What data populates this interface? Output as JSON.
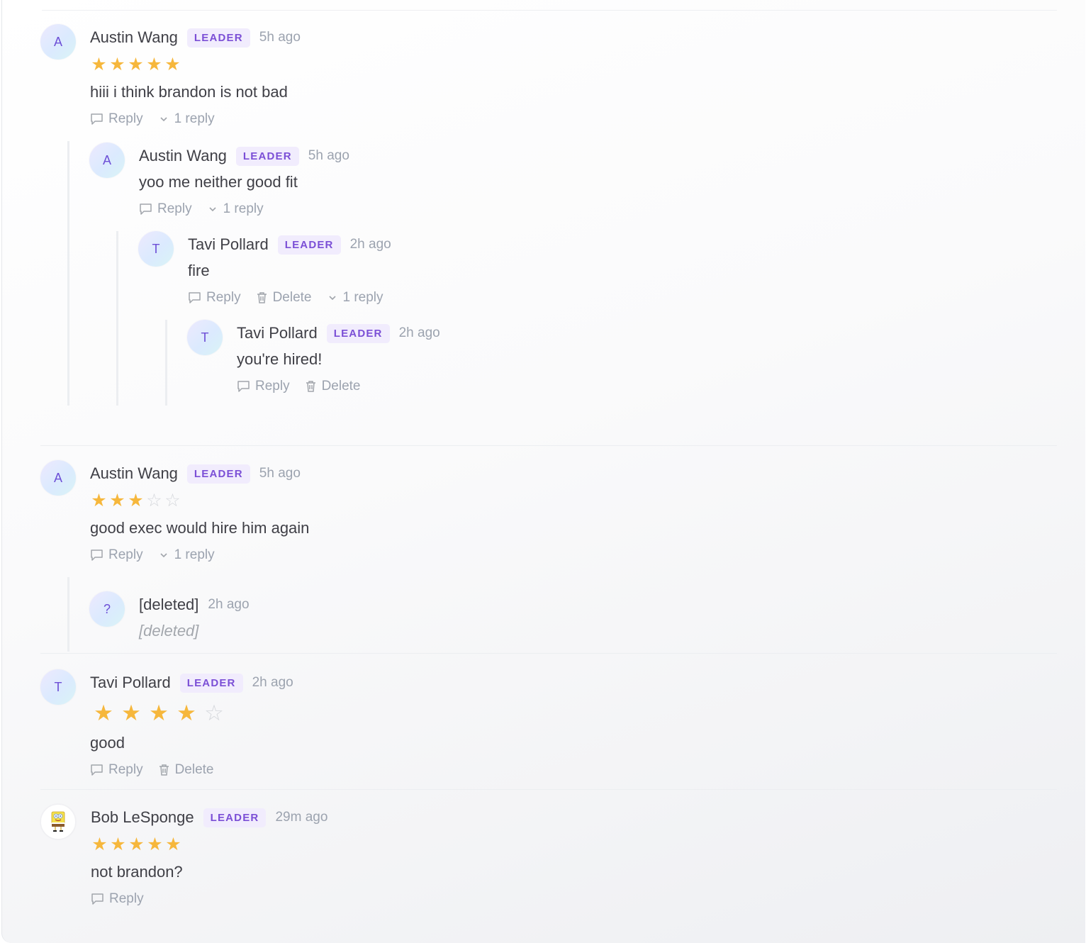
{
  "labels": {
    "reply": "Reply",
    "delete": "Delete"
  },
  "comments": [
    {
      "avatar": "A",
      "author": "Austin Wang",
      "badge": "LEADER",
      "time": "5h ago",
      "rating": 5,
      "text": "hiii i think brandon is not bad",
      "replies_count": "1 reply",
      "replies": [
        {
          "avatar": "A",
          "author": "Austin Wang",
          "badge": "LEADER",
          "time": "5h ago",
          "text": "yoo me neither good fit",
          "replies_count": "1 reply",
          "replies": [
            {
              "avatar": "T",
              "author": "Tavi Pollard",
              "badge": "LEADER",
              "time": "2h ago",
              "text": "fire",
              "replies_count": "1 reply",
              "replies": [
                {
                  "avatar": "T",
                  "author": "Tavi Pollard",
                  "badge": "LEADER",
                  "time": "2h ago",
                  "text": "you're hired!"
                }
              ]
            }
          ]
        }
      ]
    },
    {
      "avatar": "A",
      "author": "Austin Wang",
      "badge": "LEADER",
      "time": "5h ago",
      "rating": 3,
      "text": "good exec would hire him again",
      "replies_count": "1 reply",
      "replies": [
        {
          "avatar": "?",
          "author": "[deleted]",
          "time": "2h ago",
          "text": "[deleted]"
        }
      ]
    },
    {
      "avatar": "T",
      "author": "Tavi Pollard",
      "badge": "LEADER",
      "time": "2h ago",
      "rating": 4,
      "text": "good"
    },
    {
      "avatar_icon": "sponge-character-avatar",
      "author": "Bob LeSponge",
      "badge": "LEADER",
      "time": "29m ago",
      "rating": 5,
      "text": "not brandon?"
    }
  ]
}
